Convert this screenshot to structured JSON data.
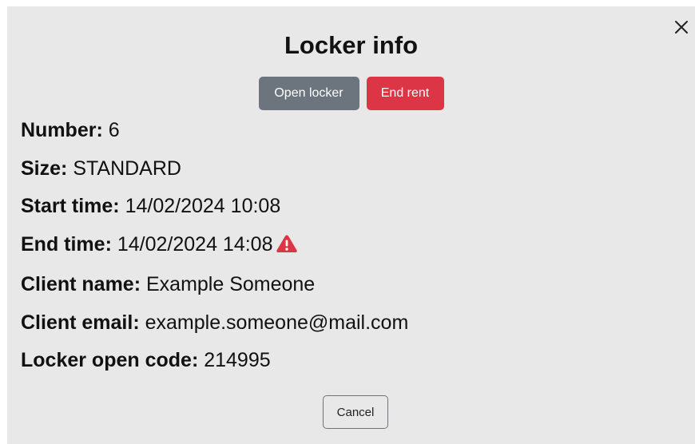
{
  "dialog": {
    "title": "Locker info",
    "close_icon": "close-icon",
    "open_locker_label": "Open locker",
    "end_rent_label": "End rent",
    "cancel_label": "Cancel"
  },
  "colors": {
    "backdrop": "#e8e8e8",
    "secondary_button": "#6c757d",
    "danger_button": "#dc3545",
    "warning_icon": "#dc3545"
  },
  "details": {
    "number": {
      "label": "Number:",
      "value": "6"
    },
    "size": {
      "label": "Size:",
      "value": "STANDARD"
    },
    "start_time": {
      "label": "Start time:",
      "value": "14/02/2024 10:08"
    },
    "end_time": {
      "label": "End time:",
      "value": "14/02/2024 14:08",
      "icon": "warning-triangle-icon"
    },
    "client_name": {
      "label": "Client name:",
      "value": "Example Someone"
    },
    "client_email": {
      "label": "Client email:",
      "value": "example.someone@mail.com"
    },
    "open_code": {
      "label": "Locker open code:",
      "value": "214995"
    }
  }
}
